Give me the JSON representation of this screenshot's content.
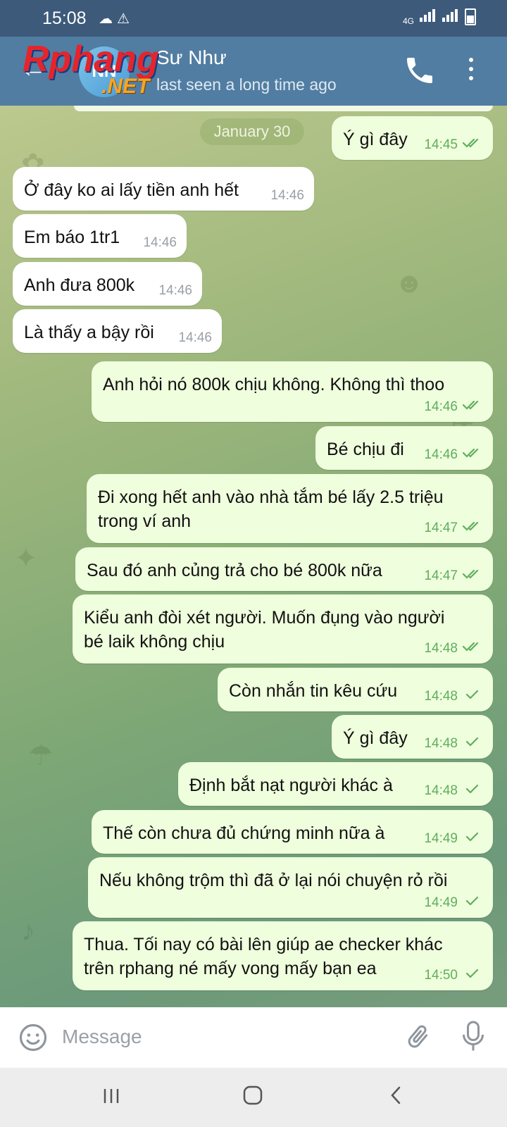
{
  "status_bar": {
    "time": "15:08",
    "network": "4G"
  },
  "header": {
    "back_icon": "arrow-left-icon",
    "avatar_initials": "NN",
    "contact_name": "Sư Như",
    "contact_status": "last seen a long time ago",
    "watermark_main": "Rphang",
    "watermark_suffix": ".NET"
  },
  "chat": {
    "date_separator": "January 30",
    "messages": [
      {
        "dir": "out",
        "text": "Ý gì đây",
        "time": "14:45",
        "status": "read"
      },
      {
        "dir": "in",
        "text": "Ở đây ko ai lấy tiền anh hết",
        "time": "14:46"
      },
      {
        "dir": "in",
        "text": "Em báo 1tr1",
        "time": "14:46"
      },
      {
        "dir": "in",
        "text": "Anh đưa 800k",
        "time": "14:46"
      },
      {
        "dir": "in",
        "text": "Là thấy a bậy rồi",
        "time": "14:46"
      },
      {
        "dir": "out",
        "text": "Anh hỏi nó 800k chịu không. Không thì thoo",
        "time": "14:46",
        "status": "read"
      },
      {
        "dir": "out",
        "text": "Bé chịu đi",
        "time": "14:46",
        "status": "read"
      },
      {
        "dir": "out",
        "text": "Đi xong hết anh vào nhà tắm bé lấy 2.5 triệu\ntrong ví anh",
        "time": "14:47",
        "status": "read"
      },
      {
        "dir": "out",
        "text": "Sau đó anh củng trả cho bé 800k nữa",
        "time": "14:47",
        "status": "read"
      },
      {
        "dir": "out",
        "text": "Kiểu anh đòi xét người. Muốn đụng vào người\nbé laik không chịu",
        "time": "14:48",
        "status": "read"
      },
      {
        "dir": "out",
        "text": "Còn nhắn tin kêu cứu",
        "time": "14:48",
        "status": "sent"
      },
      {
        "dir": "out",
        "text": "Ý gì đây",
        "time": "14:48",
        "status": "sent"
      },
      {
        "dir": "out",
        "text": "Định bắt nạt người khác à",
        "time": "14:48",
        "status": "sent"
      },
      {
        "dir": "out",
        "text": "Thế còn chưa đủ chứng minh nữa à",
        "time": "14:49",
        "status": "sent"
      },
      {
        "dir": "out",
        "text": "Nếu không trộm thì đã ở lại nói chuyện rỏ rồi",
        "time": "14:49",
        "status": "sent"
      },
      {
        "dir": "out",
        "text": "Thua. Tối nay có bài lên giúp ae checker khác\ntrên rphang né mấy vong mấy bạn ea",
        "time": "14:50",
        "status": "sent"
      }
    ]
  },
  "composer": {
    "placeholder": "Message"
  },
  "colors": {
    "header": "#517da2",
    "status_bar": "#3d5a7a",
    "bubble_out": "#effedd",
    "bubble_in": "#ffffff",
    "check": "#5fae5d"
  }
}
